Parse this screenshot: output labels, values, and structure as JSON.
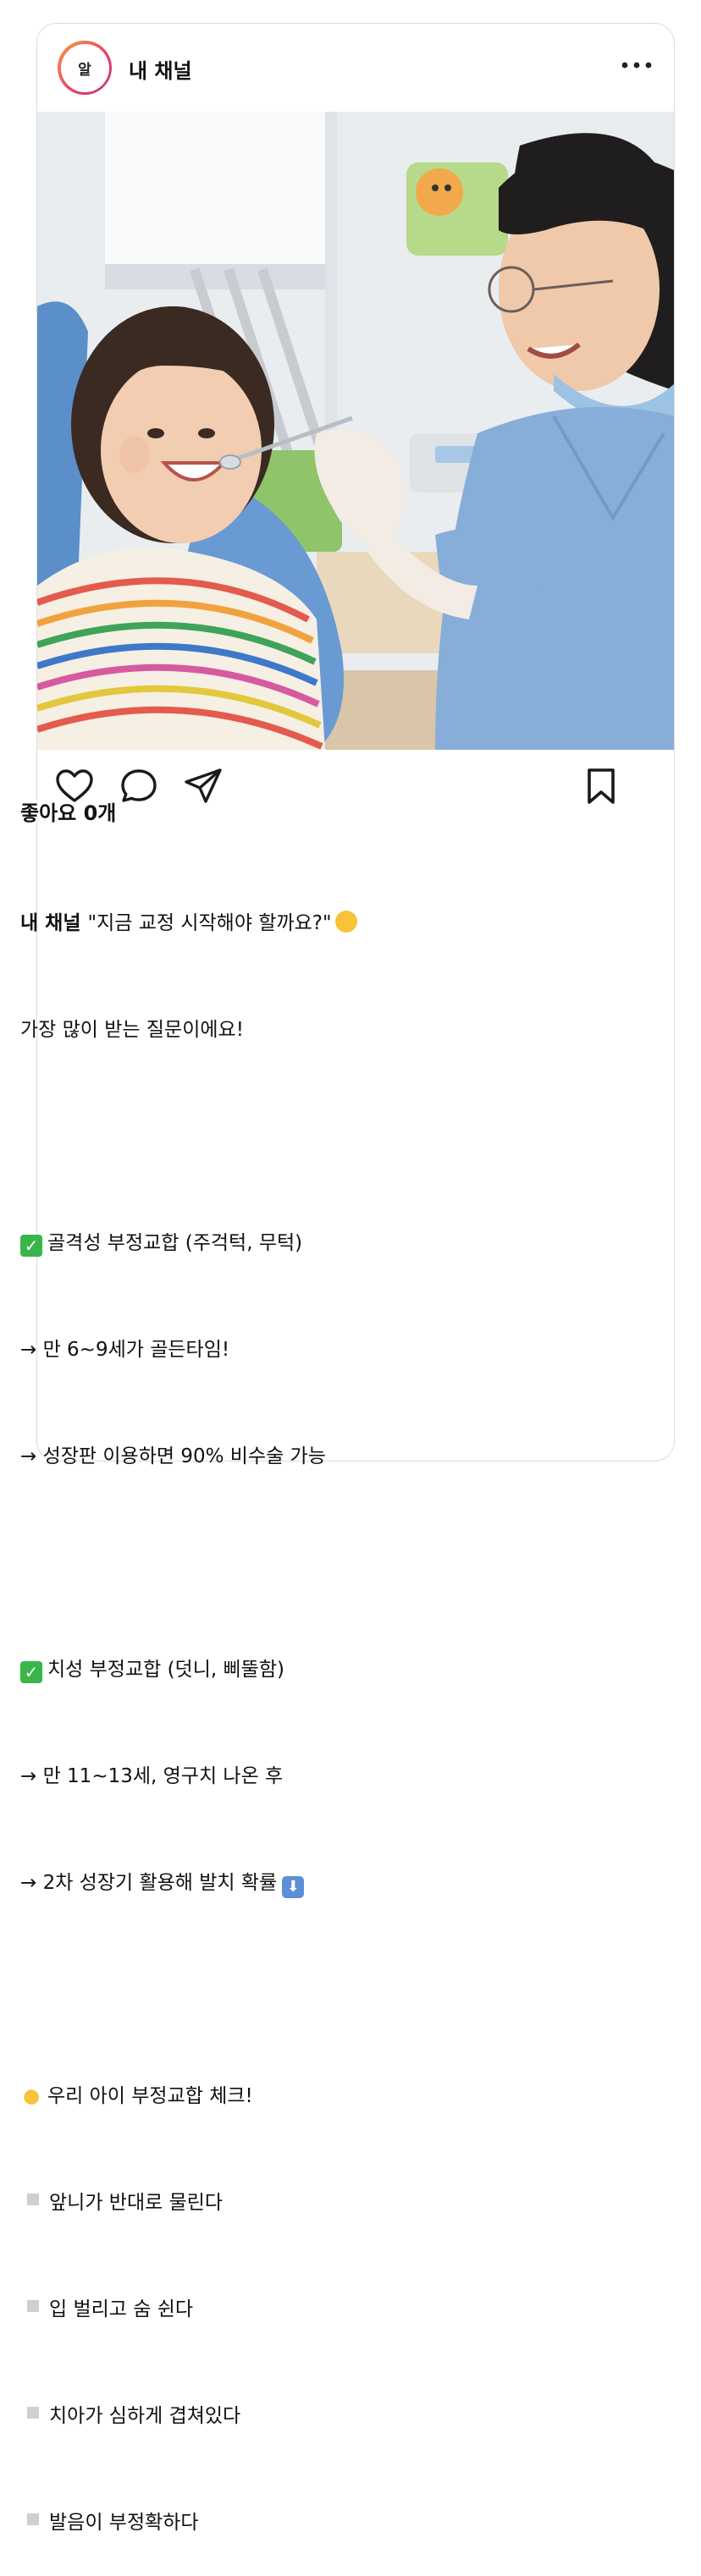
{
  "header": {
    "avatar_text": "알",
    "channel_name": "내 채널",
    "more_icon": "more-horizontal-icon"
  },
  "photo": {
    "description_icon": "post-photo"
  },
  "actions": {
    "like_icon": "heart-icon",
    "comment_icon": "comment-icon",
    "share_icon": "send-icon",
    "save_icon": "bookmark-icon"
  },
  "likes": "좋아요 0개",
  "caption": {
    "author": "내 채널",
    "first_line": "\"지금 교정 시작해야 할까요?\"",
    "line2": "가장 많이 받는 질문이에요!",
    "section1_title": "골격성 부정교합 (주걱턱, 무턱)",
    "section1_item1": "→ 만 6~9세가 골든타임!",
    "section1_item2": "→ 성장판 이용하면 90% 비수술 가능",
    "section2_title": "치성 부정교합 (덧니, 삐뚤함)",
    "section2_item1": "→ 만 11~13세, 영구치 나온 후",
    "section2_item2": "→ 2차 성장기 활용해 발치 확률",
    "section3_title": "우리 아이 부정교합 체크!",
    "check1": "앞니가 반대로 물린다",
    "check2": "입 벌리고 숨 쉰다",
    "check3": "치아가 심하게 겹쳐있다",
    "check4": "발음이 부정확하다"
  },
  "colors": {
    "ring_start": "#f7a23b",
    "ring_end": "#c13584",
    "check_green": "#3ab54a"
  }
}
